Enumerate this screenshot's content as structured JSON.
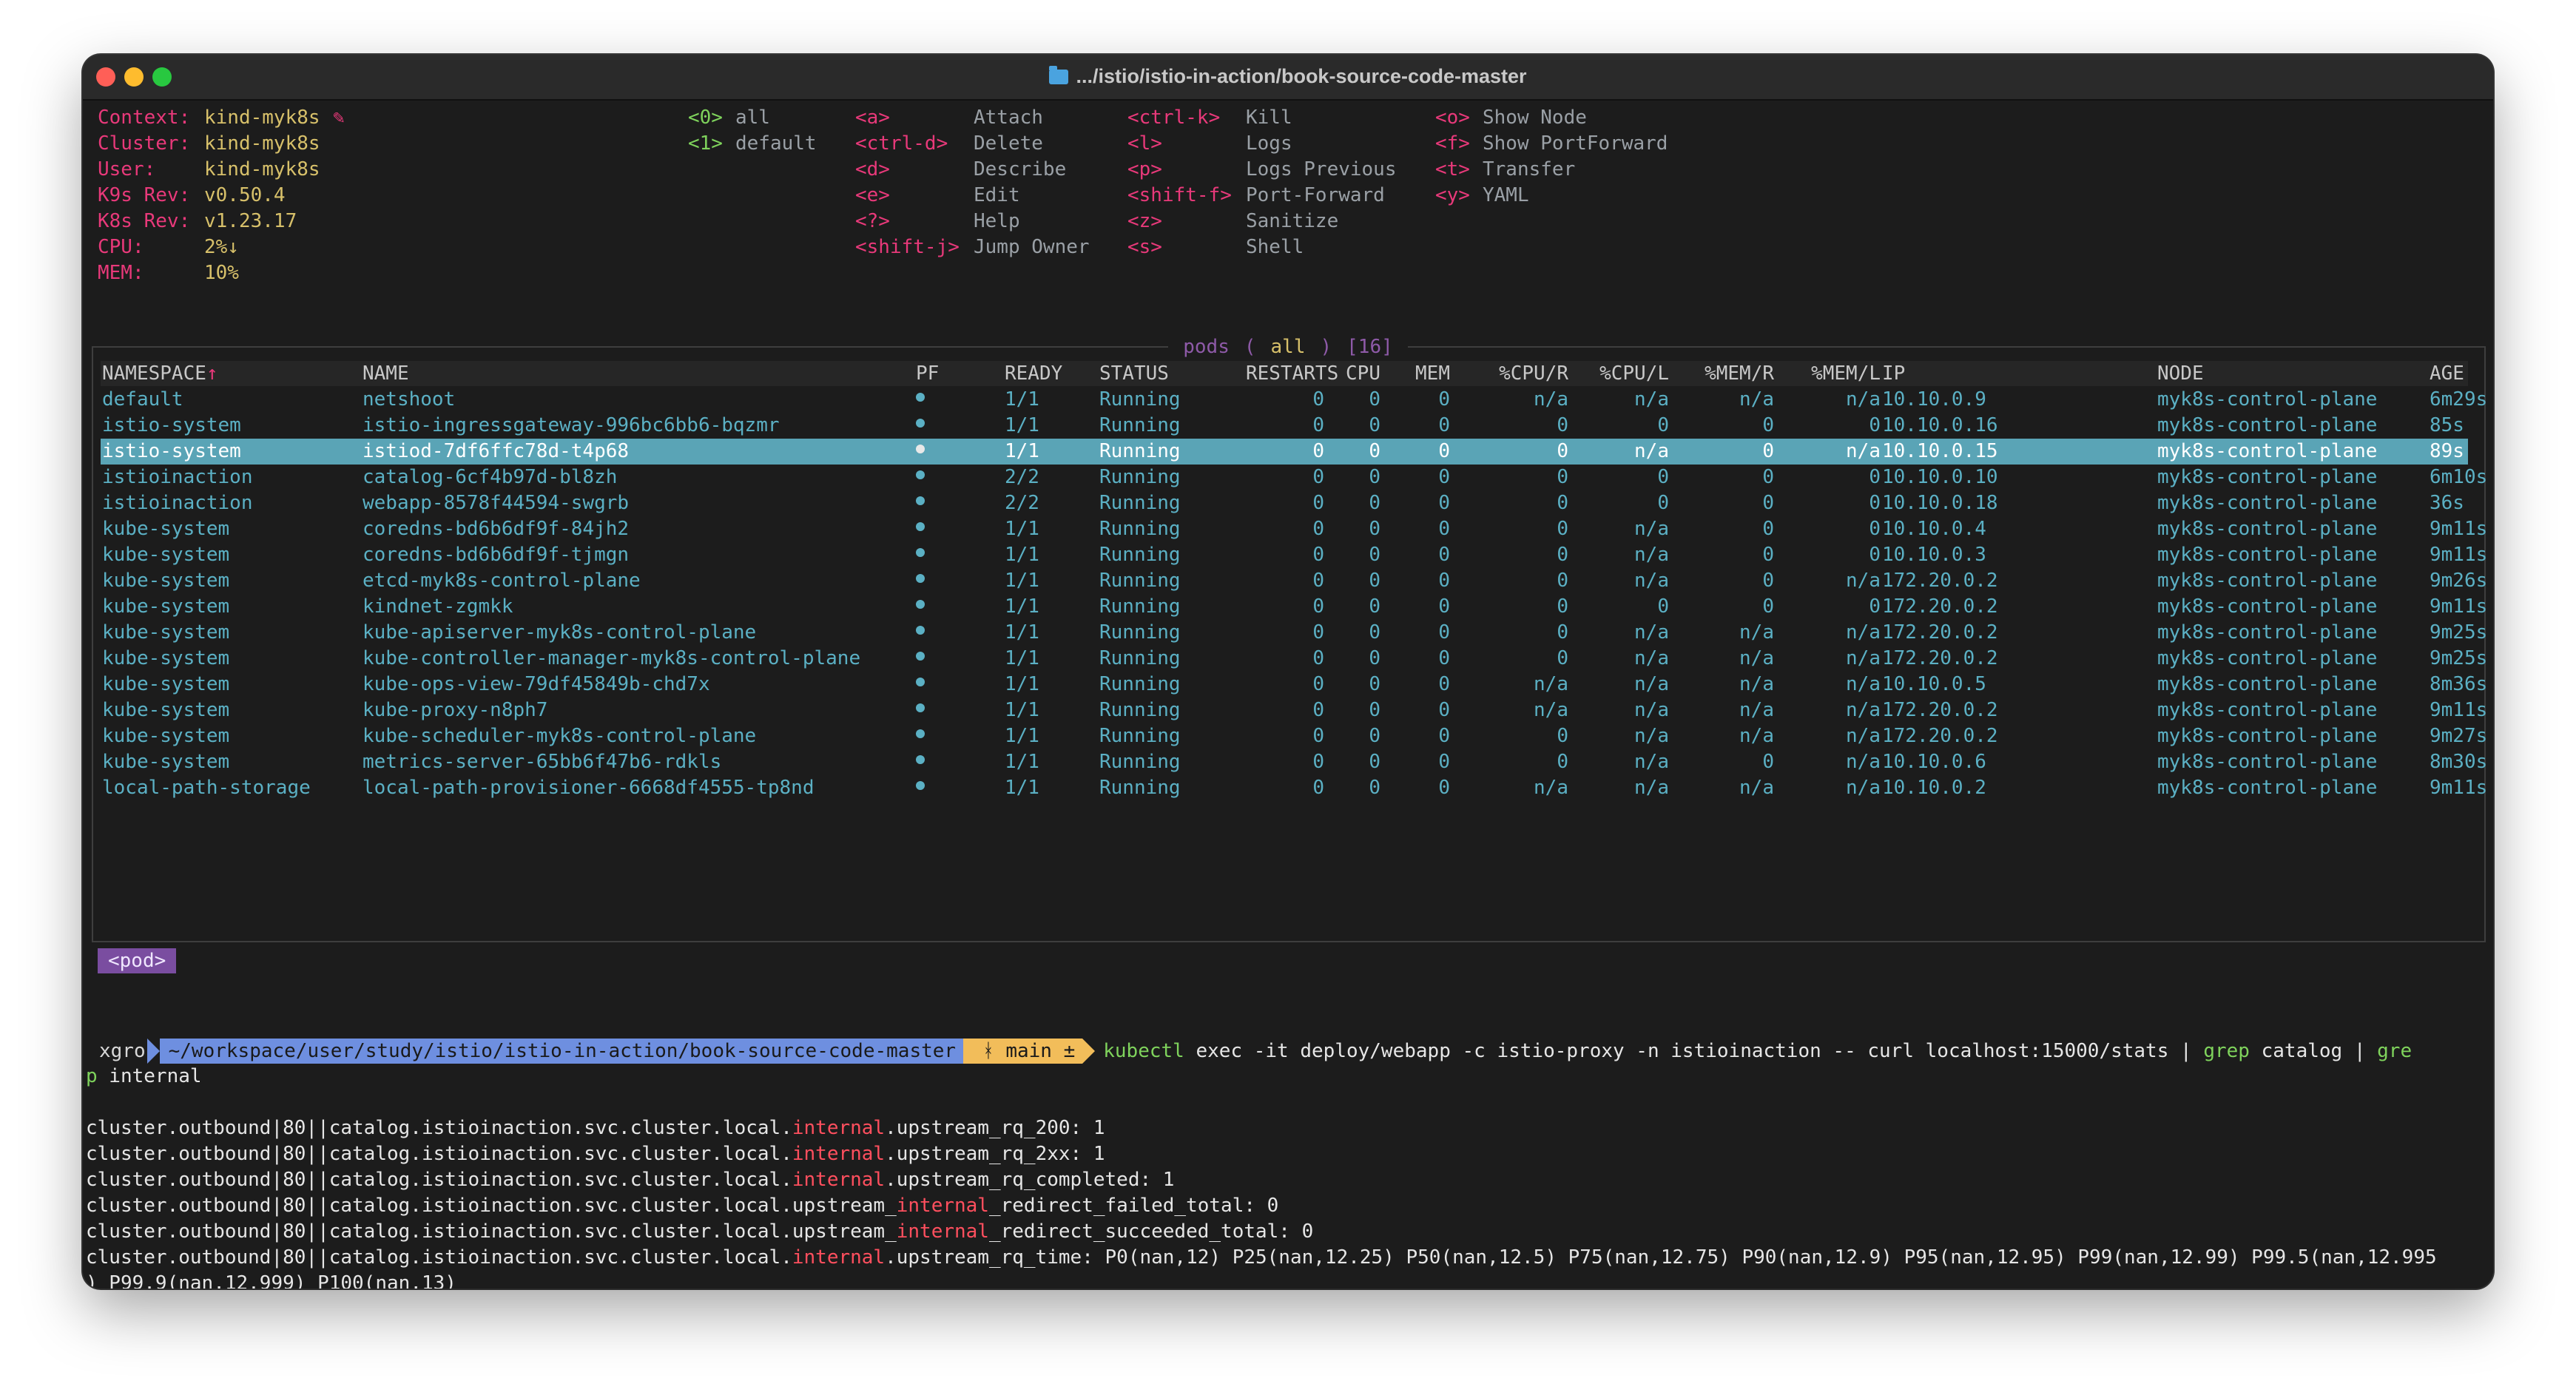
{
  "window": {
    "title": ".../istio/istio-in-action/book-source-code-master"
  },
  "k9s": {
    "info": [
      {
        "label": "Context:",
        "value": "kind-myk8s",
        "pencil": "✎"
      },
      {
        "label": "Cluster:",
        "value": "kind-myk8s"
      },
      {
        "label": "User:",
        "value": "kind-myk8s"
      },
      {
        "label": "K9s Rev:",
        "value": "v0.50.4"
      },
      {
        "label": "K8s Rev:",
        "value": "v1.23.17"
      },
      {
        "label": "CPU:",
        "value": "2%↓"
      },
      {
        "label": "MEM:",
        "value": "10%"
      }
    ],
    "namespaces": [
      {
        "key": "<0>",
        "label": "all"
      },
      {
        "key": "<1>",
        "label": "default"
      }
    ],
    "shortcuts_col1": [
      {
        "key": "<a>",
        "label": "Attach"
      },
      {
        "key": "<ctrl-d>",
        "label": "Delete"
      },
      {
        "key": "<d>",
        "label": "Describe"
      },
      {
        "key": "<e>",
        "label": "Edit"
      },
      {
        "key": "<?>",
        "label": "Help"
      },
      {
        "key": "<shift-j>",
        "label": "Jump Owner"
      }
    ],
    "shortcuts_col2": [
      {
        "key": "<ctrl-k>",
        "label": "Kill"
      },
      {
        "key": "<l>",
        "label": "Logs"
      },
      {
        "key": "<p>",
        "label": "Logs Previous"
      },
      {
        "key": "<shift-f>",
        "label": "Port-Forward"
      },
      {
        "key": "<z>",
        "label": "Sanitize"
      },
      {
        "key": "<s>",
        "label": "Shell"
      }
    ],
    "shortcuts_col3": [
      {
        "key": "<o>",
        "label": "Show Node"
      },
      {
        "key": "<f>",
        "label": "Show PortForward"
      },
      {
        "key": "<t>",
        "label": "Transfer"
      },
      {
        "key": "<y>",
        "label": "YAML"
      }
    ],
    "pane_title": {
      "resource": "pods",
      "scope": "all",
      "count": "[16]"
    },
    "breadcrumb": "<pod>",
    "columns": [
      "NAMESPACE↑",
      "NAME",
      "PF",
      "READY",
      "STATUS",
      "RESTARTS",
      "CPU",
      "MEM",
      "%CPU/R",
      "%CPU/L",
      "%MEM/R",
      "%MEM/L",
      "IP",
      "NODE",
      "AGE"
    ],
    "pods": [
      [
        "default",
        "netshoot",
        "●",
        "1/1",
        "Running",
        "0",
        "0",
        "0",
        "n/a",
        "n/a",
        "n/a",
        "n/a",
        "10.10.0.9",
        "myk8s-control-plane",
        "6m29s"
      ],
      [
        "istio-system",
        "istio-ingressgateway-996bc6bb6-bqzmr",
        "●",
        "1/1",
        "Running",
        "0",
        "0",
        "0",
        "0",
        "0",
        "0",
        "0",
        "10.10.0.16",
        "myk8s-control-plane",
        "85s"
      ],
      [
        "istio-system",
        "istiod-7df6ffc78d-t4p68",
        "●",
        "1/1",
        "Running",
        "0",
        "0",
        "0",
        "0",
        "n/a",
        "0",
        "n/a",
        "10.10.0.15",
        "myk8s-control-plane",
        "89s"
      ],
      [
        "istioinaction",
        "catalog-6cf4b97d-bl8zh",
        "●",
        "2/2",
        "Running",
        "0",
        "0",
        "0",
        "0",
        "0",
        "0",
        "0",
        "10.10.0.10",
        "myk8s-control-plane",
        "6m10s"
      ],
      [
        "istioinaction",
        "webapp-8578f44594-swgrb",
        "●",
        "2/2",
        "Running",
        "0",
        "0",
        "0",
        "0",
        "0",
        "0",
        "0",
        "10.10.0.18",
        "myk8s-control-plane",
        "36s"
      ],
      [
        "kube-system",
        "coredns-bd6b6df9f-84jh2",
        "●",
        "1/1",
        "Running",
        "0",
        "0",
        "0",
        "0",
        "n/a",
        "0",
        "0",
        "10.10.0.4",
        "myk8s-control-plane",
        "9m11s"
      ],
      [
        "kube-system",
        "coredns-bd6b6df9f-tjmgn",
        "●",
        "1/1",
        "Running",
        "0",
        "0",
        "0",
        "0",
        "n/a",
        "0",
        "0",
        "10.10.0.3",
        "myk8s-control-plane",
        "9m11s"
      ],
      [
        "kube-system",
        "etcd-myk8s-control-plane",
        "●",
        "1/1",
        "Running",
        "0",
        "0",
        "0",
        "0",
        "n/a",
        "0",
        "n/a",
        "172.20.0.2",
        "myk8s-control-plane",
        "9m26s"
      ],
      [
        "kube-system",
        "kindnet-zgmkk",
        "●",
        "1/1",
        "Running",
        "0",
        "0",
        "0",
        "0",
        "0",
        "0",
        "0",
        "172.20.0.2",
        "myk8s-control-plane",
        "9m11s"
      ],
      [
        "kube-system",
        "kube-apiserver-myk8s-control-plane",
        "●",
        "1/1",
        "Running",
        "0",
        "0",
        "0",
        "0",
        "n/a",
        "n/a",
        "n/a",
        "172.20.0.2",
        "myk8s-control-plane",
        "9m25s"
      ],
      [
        "kube-system",
        "kube-controller-manager-myk8s-control-plane",
        "●",
        "1/1",
        "Running",
        "0",
        "0",
        "0",
        "0",
        "n/a",
        "n/a",
        "n/a",
        "172.20.0.2",
        "myk8s-control-plane",
        "9m25s"
      ],
      [
        "kube-system",
        "kube-ops-view-79df45849b-chd7x",
        "●",
        "1/1",
        "Running",
        "0",
        "0",
        "0",
        "n/a",
        "n/a",
        "n/a",
        "n/a",
        "10.10.0.5",
        "myk8s-control-plane",
        "8m36s"
      ],
      [
        "kube-system",
        "kube-proxy-n8ph7",
        "●",
        "1/1",
        "Running",
        "0",
        "0",
        "0",
        "n/a",
        "n/a",
        "n/a",
        "n/a",
        "172.20.0.2",
        "myk8s-control-plane",
        "9m11s"
      ],
      [
        "kube-system",
        "kube-scheduler-myk8s-control-plane",
        "●",
        "1/1",
        "Running",
        "0",
        "0",
        "0",
        "0",
        "n/a",
        "n/a",
        "n/a",
        "172.20.0.2",
        "myk8s-control-plane",
        "9m27s"
      ],
      [
        "kube-system",
        "metrics-server-65bb6f47b6-rdkls",
        "●",
        "1/1",
        "Running",
        "0",
        "0",
        "0",
        "0",
        "n/a",
        "0",
        "n/a",
        "10.10.0.6",
        "myk8s-control-plane",
        "8m30s"
      ],
      [
        "local-path-storage",
        "local-path-provisioner-6668df4555-tp8nd",
        "●",
        "1/1",
        "Running",
        "0",
        "0",
        "0",
        "n/a",
        "n/a",
        "n/a",
        "n/a",
        "10.10.0.2",
        "myk8s-control-plane",
        "9m11s"
      ]
    ],
    "selected_row": 2
  },
  "shell": {
    "user": "xgro",
    "path": "~/workspace/user/study/istio/istio-in-action/book-source-code-master",
    "git": "ᚼ main ±",
    "command": {
      "a": "kubectl",
      "b": " exec -it deploy/webapp -c istio-proxy -n istioinaction -- curl localhost:15000/stats | ",
      "c": "grep",
      "d": " catalog | ",
      "e": "gre",
      "wrap_1": "p",
      "wrap_2": " internal"
    },
    "output": [
      [
        "cluster.outbound|80||catalog.istioinaction.svc.cluster.local.",
        "internal",
        ".upstream_rq_200: 1"
      ],
      [
        "cluster.outbound|80||catalog.istioinaction.svc.cluster.local.",
        "internal",
        ".upstream_rq_2xx: 1"
      ],
      [
        "cluster.outbound|80||catalog.istioinaction.svc.cluster.local.",
        "internal",
        ".upstream_rq_completed: 1"
      ],
      [
        "cluster.outbound|80||catalog.istioinaction.svc.cluster.local.upstream_",
        "internal",
        "_redirect_failed_total: 0"
      ],
      [
        "cluster.outbound|80||catalog.istioinaction.svc.cluster.local.upstream_",
        "internal",
        "_redirect_succeeded_total: 0"
      ],
      [
        "cluster.outbound|80||catalog.istioinaction.svc.cluster.local.",
        "internal",
        ".upstream_rq_time: P0(nan,12) P25(nan,12.25) P50(nan,12.5) P75(nan,12.75) P90(nan,12.9) P95(nan,12.95) P99(nan,12.99) P99.5(nan,12.995"
      ],
      [
        ") P99.9(nan,12.999) P100(nan,13)",
        "",
        ""
      ]
    ]
  }
}
